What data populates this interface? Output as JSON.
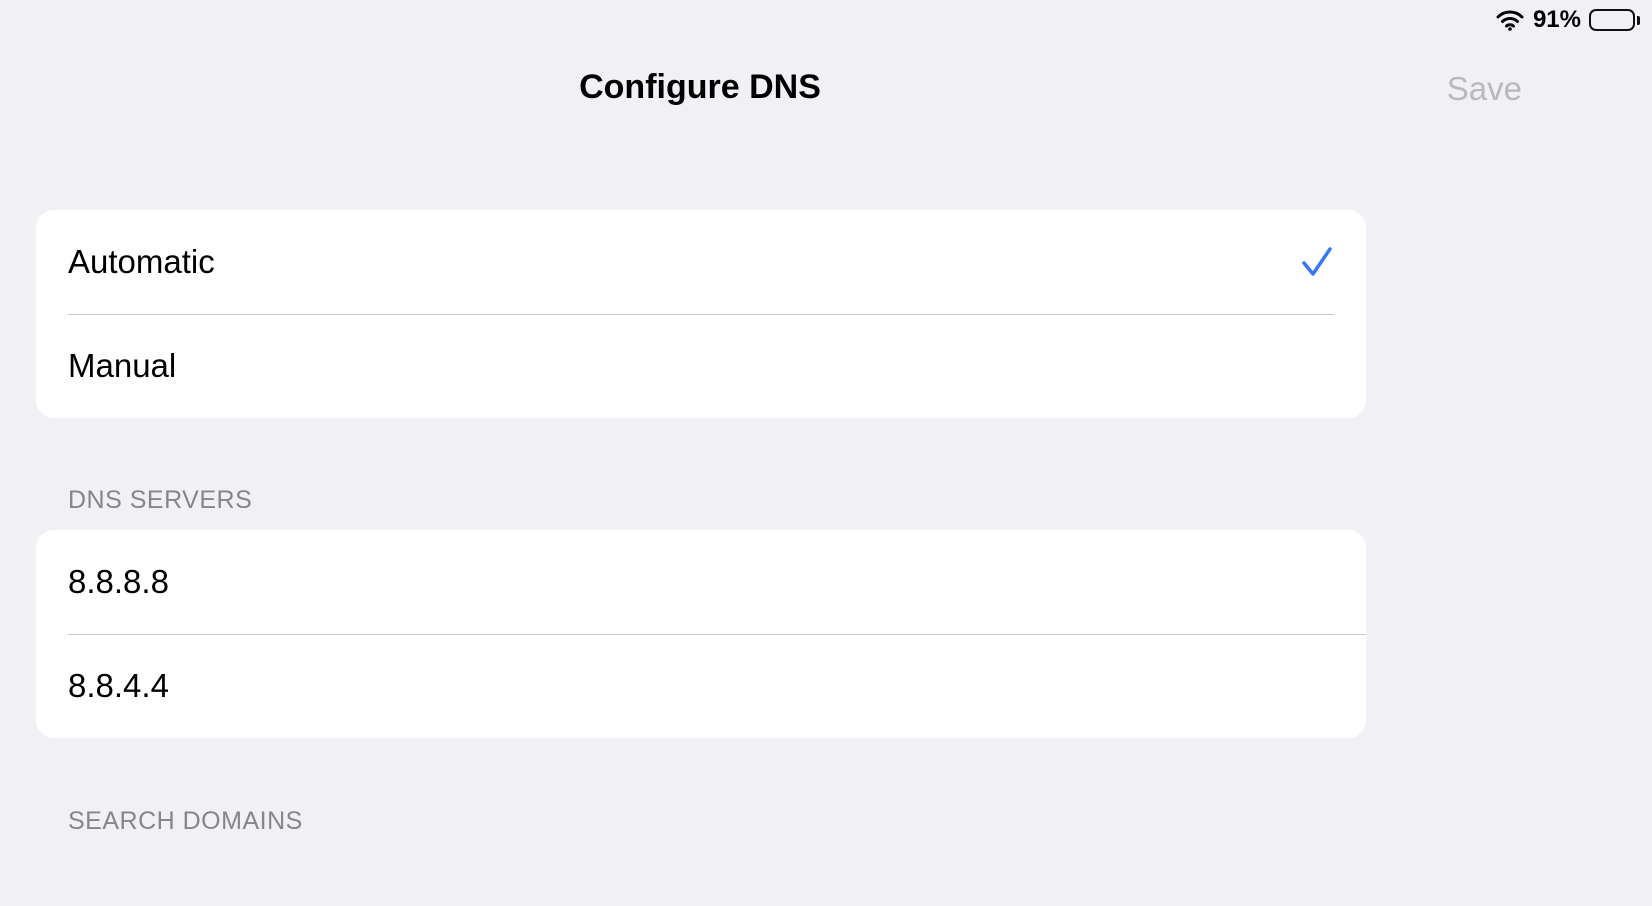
{
  "status_bar": {
    "battery_text": "91%",
    "battery_level": 0.91
  },
  "nav": {
    "title": "Configure DNS",
    "save_label": "Save"
  },
  "mode_options": [
    {
      "label": "Automatic",
      "selected": true
    },
    {
      "label": "Manual",
      "selected": false
    }
  ],
  "dns_servers": {
    "header": "DNS SERVERS",
    "items": [
      "8.8.8.8",
      "8.8.4.4"
    ]
  },
  "search_domains": {
    "header": "SEARCH DOMAINS"
  },
  "colors": {
    "background": "#f1f0f5",
    "accent": "#3478f6",
    "disabled_text": "#b8b8bd",
    "section_header": "#85858b"
  }
}
